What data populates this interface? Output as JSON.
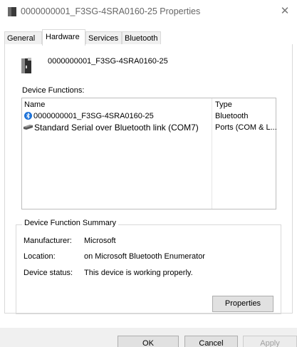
{
  "window": {
    "title": "0000000001_F3SG-4SRA0160-25 Properties",
    "close_glyph": "✕"
  },
  "tabs": [
    {
      "label": "General",
      "active": false
    },
    {
      "label": "Hardware",
      "active": true
    },
    {
      "label": "Services",
      "active": false
    },
    {
      "label": "Bluetooth",
      "active": false
    }
  ],
  "device": {
    "name": "0000000001_F3SG-4SRA0160-25",
    "icon": "device-icon"
  },
  "functions": {
    "label": "Device Functions:",
    "columns": [
      "Name",
      "Type"
    ],
    "rows": [
      {
        "name": "0000000001_F3SG-4SRA0160-25",
        "type": "Bluetooth",
        "icon": "bluetooth-icon"
      },
      {
        "name": "Standard Serial over Bluetooth link (COM7)",
        "type": "Ports (COM & L...",
        "icon": "port-icon"
      }
    ]
  },
  "summary": {
    "title": "Device Function Summary",
    "manufacturer_label": "Manufacturer:",
    "manufacturer_value": "Microsoft",
    "location_label": "Location:",
    "location_value": "on Microsoft Bluetooth Enumerator",
    "status_label": "Device status:",
    "status_value": "This device is working properly.",
    "properties_button": "Properties"
  },
  "buttons": {
    "ok": "OK",
    "cancel": "Cancel",
    "apply": "Apply"
  },
  "colors": {
    "bluetooth_blue": "#1e73d9",
    "disabled_text": "#a0a0a0"
  }
}
